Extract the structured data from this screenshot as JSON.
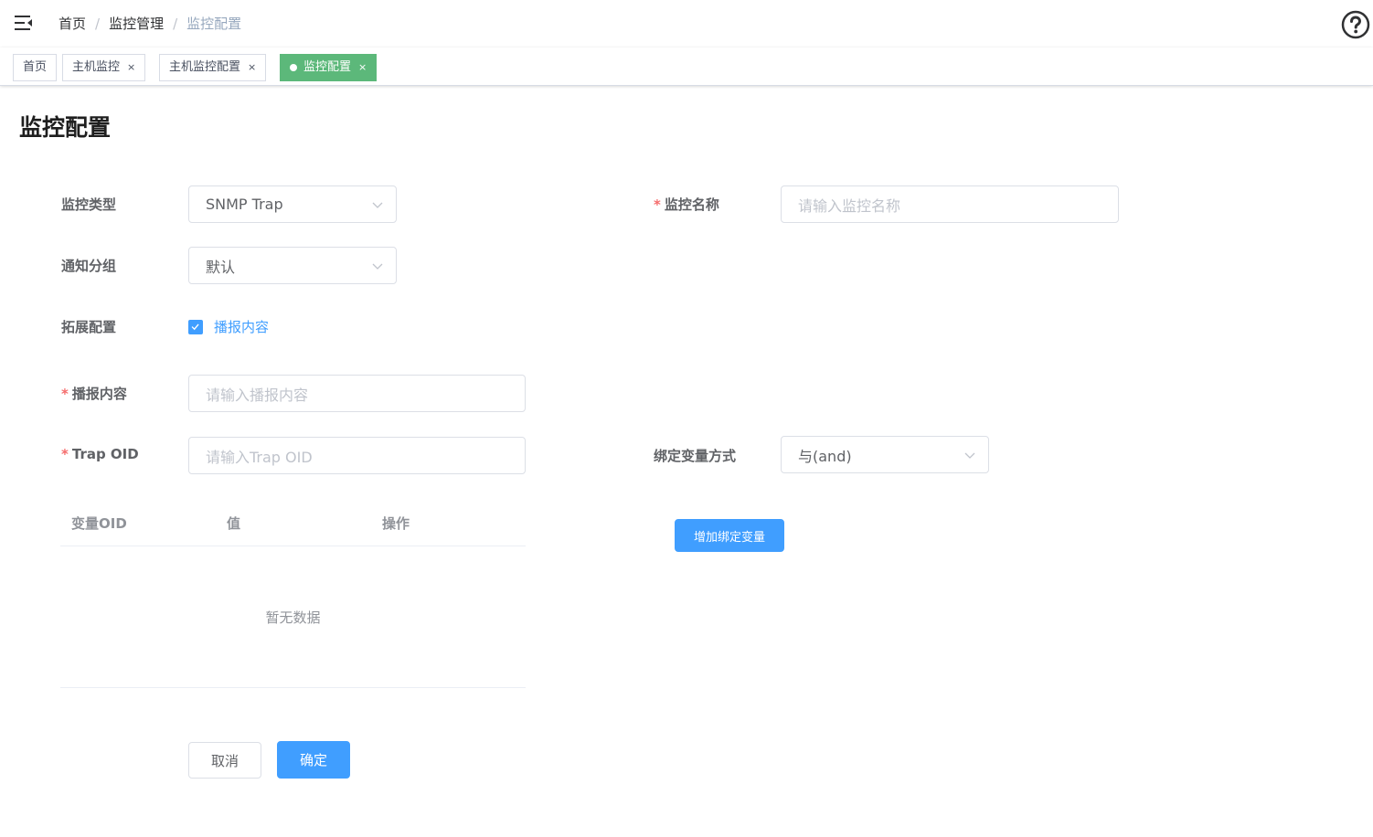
{
  "navbar": {
    "menu_icon": "hamburger-fold-icon",
    "breadcrumb": [
      "首页",
      "监控管理",
      "监控配置"
    ],
    "separator": "/",
    "help_icon": "question-circle-icon"
  },
  "tags": [
    {
      "label": "首页",
      "active": false,
      "closable": false
    },
    {
      "label": "主机监控",
      "active": false,
      "closable": true
    },
    {
      "label": "主机监控配置",
      "active": false,
      "closable": true
    },
    {
      "label": "监控配置",
      "active": true,
      "closable": true
    }
  ],
  "tag_close_glyph": "×",
  "page": {
    "title": "监控配置"
  },
  "form": {
    "required_mark": "*",
    "monitor_type": {
      "label": "监控类型",
      "value": "SNMP Trap"
    },
    "monitor_name": {
      "label": "监控名称",
      "placeholder": "请输入监控名称",
      "required": true
    },
    "notify_group": {
      "label": "通知分组",
      "value": "默认"
    },
    "ext_config": {
      "label": "拓展配置",
      "checkbox_label": "播报内容",
      "checked": true
    },
    "broadcast": {
      "label": "播报内容",
      "placeholder": "请输入播报内容",
      "required": true
    },
    "trap_oid": {
      "label": "Trap OID",
      "placeholder": "请输入Trap OID",
      "required": true
    },
    "bind_mode": {
      "label": "绑定变量方式",
      "value": "与(and)"
    }
  },
  "table": {
    "columns": [
      "变量OID",
      "值",
      "操作"
    ],
    "rows": [],
    "empty_text": "暂无数据"
  },
  "buttons": {
    "add_binding": "增加绑定变量",
    "cancel": "取消",
    "confirm": "确定"
  },
  "colors": {
    "primary": "#409eff",
    "tag_active": "#5cb87a",
    "required": "#f56c6c"
  }
}
